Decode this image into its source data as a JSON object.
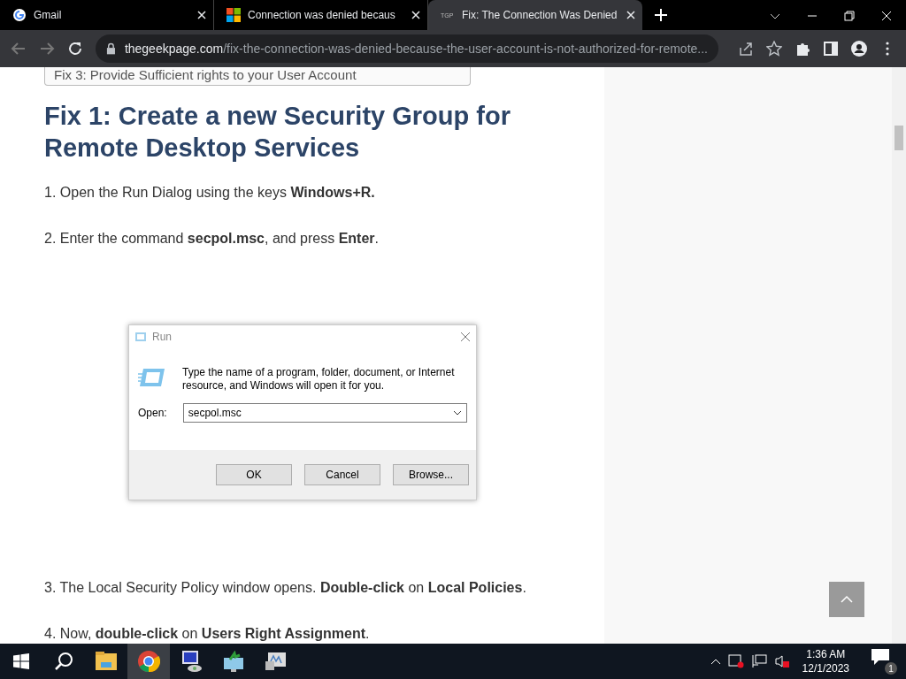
{
  "browser": {
    "tabs": [
      {
        "title": "Gmail",
        "kind": "google",
        "selected": false
      },
      {
        "title": "Connection was denied becaus",
        "kind": "microsoft",
        "selected": false
      },
      {
        "title": "Fix: The Connection Was Denied",
        "kind": "site",
        "favicon_text": "TGP",
        "selected": true
      }
    ],
    "address": {
      "domain": "thegeekpage.com",
      "path": "/fix-the-connection-was-denied-because-the-user-account-is-not-authorized-for-remote..."
    }
  },
  "article": {
    "toc_item": "Fix 3: Provide Sufficient rights to your User Account",
    "heading": "Fix 1: Create a new Security Group for Remote Desktop Services",
    "steps_before": [
      "1. Open the Run Dialog using the keys **Windows+R.**",
      "2. Enter the command **secpol.msc**, and press **Enter**."
    ],
    "run_dialog": {
      "title": "Run",
      "message": "Type the name of a program, folder, document, or Internet resource, and Windows will open it for you.",
      "open_label": "Open:",
      "value": "secpol.msc",
      "buttons": [
        "OK",
        "Cancel",
        "Browse..."
      ]
    },
    "steps_after": [
      "3. The Local Security Policy window opens. **Double-click** on **Local Policies**.",
      "4. Now, **double-click** on **Users Right Assignment**."
    ]
  },
  "taskbar": {
    "apps": [
      {
        "kind": "folder",
        "selected": false
      },
      {
        "kind": "chrome",
        "selected": true
      },
      {
        "kind": "remote",
        "selected": false
      },
      {
        "kind": "monitor",
        "selected": false
      },
      {
        "kind": "chart",
        "selected": false
      }
    ],
    "time": "1:36 AM",
    "date": "12/1/2023",
    "notification_count": "1"
  }
}
